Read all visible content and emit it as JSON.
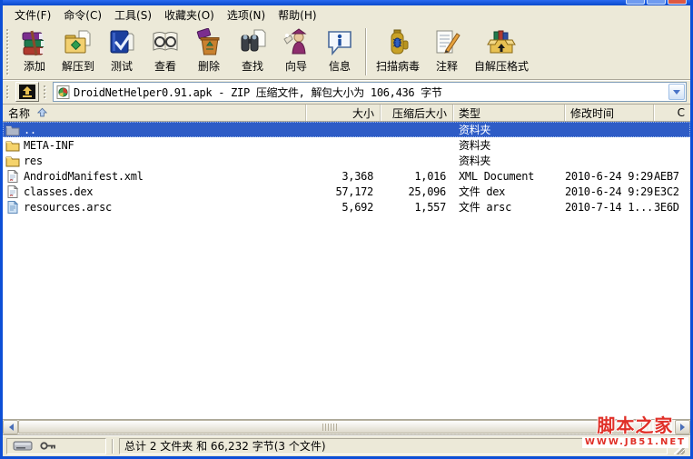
{
  "titlebar": {
    "buttons": [
      "minimize-button",
      "maximize-button",
      "close-button"
    ]
  },
  "menubar": {
    "items": [
      {
        "label": "文件(F)"
      },
      {
        "label": "命令(C)"
      },
      {
        "label": "工具(S)"
      },
      {
        "label": "收藏夹(O)"
      },
      {
        "label": "选项(N)"
      },
      {
        "label": "帮助(H)"
      }
    ]
  },
  "toolbar": {
    "buttons": [
      {
        "icon": "add-archive-icon",
        "label": "添加"
      },
      {
        "icon": "extract-to-icon",
        "label": "解压到"
      },
      {
        "icon": "test-icon",
        "label": "测试"
      },
      {
        "icon": "view-icon",
        "label": "查看"
      },
      {
        "icon": "delete-icon",
        "label": "删除"
      },
      {
        "icon": "find-icon",
        "label": "查找"
      },
      {
        "icon": "wizard-icon",
        "label": "向导"
      },
      {
        "icon": "info-icon",
        "label": "信息"
      },
      {
        "icon": "scan-virus-icon",
        "label": "扫描病毒"
      },
      {
        "icon": "comment-icon",
        "label": "注释"
      },
      {
        "icon": "sfx-icon",
        "label": "自解压格式"
      }
    ]
  },
  "addressbar": {
    "up_icon": "folder-up-icon",
    "value": "DroidNetHelper0.91.apk - ZIP 压缩文件, 解包大小为 106,436 字节"
  },
  "list": {
    "columns": [
      {
        "label": "名称",
        "sort": "asc"
      },
      {
        "label": "大小"
      },
      {
        "label": "压缩后大小"
      },
      {
        "label": "类型"
      },
      {
        "label": "修改时间"
      },
      {
        "label": "C"
      }
    ],
    "rows": [
      {
        "icon": "folder-up",
        "name": "..",
        "size": "",
        "packed": "",
        "type": "资料夹",
        "modified": "",
        "crc": "",
        "selected": true
      },
      {
        "icon": "folder",
        "name": "META-INF",
        "size": "",
        "packed": "",
        "type": "资料夹",
        "modified": "",
        "crc": ""
      },
      {
        "icon": "folder",
        "name": "res",
        "size": "",
        "packed": "",
        "type": "资料夹",
        "modified": "",
        "crc": ""
      },
      {
        "icon": "xml-file",
        "name": "AndroidManifest.xml",
        "size": "3,368",
        "packed": "1,016",
        "type": "XML Document",
        "modified": "2010-6-24 9:29",
        "crc": "AEB7"
      },
      {
        "icon": "dex-file",
        "name": "classes.dex",
        "size": "57,172",
        "packed": "25,096",
        "type": "文件 dex",
        "modified": "2010-6-24 9:29",
        "crc": "E3C2"
      },
      {
        "icon": "arsc-file",
        "name": "resources.arsc",
        "size": "5,692",
        "packed": "1,557",
        "type": "文件 arsc",
        "modified": "2010-7-14 1...",
        "crc": "3E6D"
      }
    ]
  },
  "statusbar": {
    "icons": [
      "drive-icon",
      "key-icon"
    ],
    "totals": "总计 2 文件夹 和 66,232 字节(3 个文件)"
  },
  "watermark": {
    "title": "脚本之家",
    "url": "WWW.JB51.NET"
  },
  "colors": {
    "selection_blue": "#2E5CC6",
    "xp_beige": "#ECE9D8",
    "window_border": "#0D4FD6",
    "watermark_red": "#E03028"
  }
}
